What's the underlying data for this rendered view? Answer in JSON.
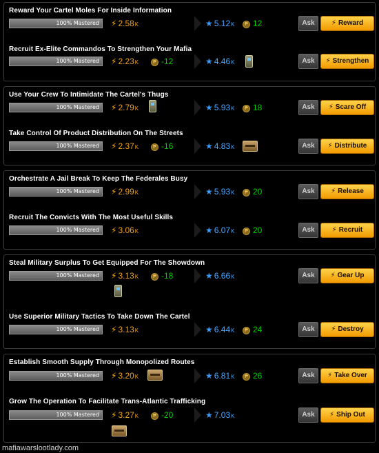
{
  "groups": [
    {
      "jobs": [
        {
          "title": "Reward Your Cartel Moles For Inside Information",
          "mastery": "100% Mastered",
          "mastery_fraction": 1.0,
          "energy": "2.58",
          "energy_unit": "K",
          "money": "",
          "xp": "5.12",
          "xp_unit": "K",
          "money_gain": "12",
          "item": "",
          "ask": "Ask",
          "action": "Reward"
        },
        {
          "title": "Recruit Ex-Elite Commandos To Strengthen Your Mafia",
          "mastery": "100% Mastered",
          "mastery_fraction": 1.0,
          "energy": "2.23",
          "energy_unit": "K",
          "money": "-12",
          "xp": "4.46",
          "xp_unit": "K",
          "money_gain": "",
          "item": "phone-icon",
          "ask": "Ask",
          "action": "Strengthen"
        }
      ]
    },
    {
      "jobs": [
        {
          "title": "Use Your Crew To Intimidate The Cartel's Thugs",
          "mastery": "100% Mastered",
          "mastery_fraction": 1.0,
          "energy": "2.79",
          "energy_unit": "K",
          "money": "",
          "xp": "5.93",
          "xp_unit": "K",
          "money_gain": "18",
          "item": "phone-icon",
          "ask": "Ask",
          "action": "Scare Off"
        },
        {
          "title": "Take Control Of Product Distribution On The Streets",
          "mastery": "100% Mastered",
          "mastery_fraction": 1.0,
          "energy": "2.37",
          "energy_unit": "K",
          "money": "-16",
          "xp": "4.83",
          "xp_unit": "K",
          "money_gain": "",
          "item": "crate-icon",
          "ask": "Ask",
          "action": "Distribute"
        }
      ]
    },
    {
      "jobs": [
        {
          "title": "Orchestrate A Jail Break To Keep The Federales Busy",
          "mastery": "100% Mastered",
          "mastery_fraction": 1.0,
          "energy": "2.99",
          "energy_unit": "K",
          "money": "",
          "xp": "5.93",
          "xp_unit": "K",
          "money_gain": "20",
          "item": "",
          "ask": "Ask",
          "action": "Release"
        },
        {
          "title": "Recruit The Convicts With The Most Useful Skills",
          "mastery": "100% Mastered",
          "mastery_fraction": 1.0,
          "energy": "3.06",
          "energy_unit": "K",
          "money": "",
          "xp": "6.07",
          "xp_unit": "K",
          "money_gain": "20",
          "item": "",
          "ask": "Ask",
          "action": "Recruit"
        }
      ]
    },
    {
      "jobs": [
        {
          "title": "Steal Military Surplus To Get Equipped For The Showdown",
          "mastery": "100% Mastered",
          "mastery_fraction": 1.0,
          "energy": "3.13",
          "energy_unit": "K",
          "money": "-18",
          "xp": "6.66",
          "xp_unit": "K",
          "money_gain": "",
          "item": "phone-icon",
          "ask": "Ask",
          "action": "Gear Up"
        },
        {
          "title": "Use Superior Military Tactics To Take Down The Cartel",
          "mastery": "100% Mastered",
          "mastery_fraction": 1.0,
          "energy": "3.13",
          "energy_unit": "K",
          "money": "",
          "xp": "6.44",
          "xp_unit": "K",
          "money_gain": "24",
          "item": "",
          "ask": "Ask",
          "action": "Destroy"
        }
      ]
    },
    {
      "jobs": [
        {
          "title": "Establish Smooth Supply Through Monopolized Routes",
          "mastery": "100% Mastered",
          "mastery_fraction": 1.0,
          "energy": "3.20",
          "energy_unit": "K",
          "money": "",
          "xp": "6.81",
          "xp_unit": "K",
          "money_gain": "26",
          "item": "crate-icon",
          "ask": "Ask",
          "action": "Take Over"
        },
        {
          "title": "Grow The Operation To Facilitate Trans-Atlantic Trafficking",
          "mastery": "100% Mastered",
          "mastery_fraction": 1.0,
          "energy": "3.27",
          "energy_unit": "K",
          "money": "-20",
          "xp": "7.03",
          "xp_unit": "K",
          "money_gain": "",
          "item": "crate-icon",
          "ask": "Ask",
          "action": "Ship Out"
        }
      ]
    }
  ],
  "watermark": "mafiawarslootlady.com",
  "colors": {
    "energy": "#f0a020",
    "xp": "#4aa8ff",
    "money": "#00d000",
    "action_button": "#f7b21f"
  }
}
